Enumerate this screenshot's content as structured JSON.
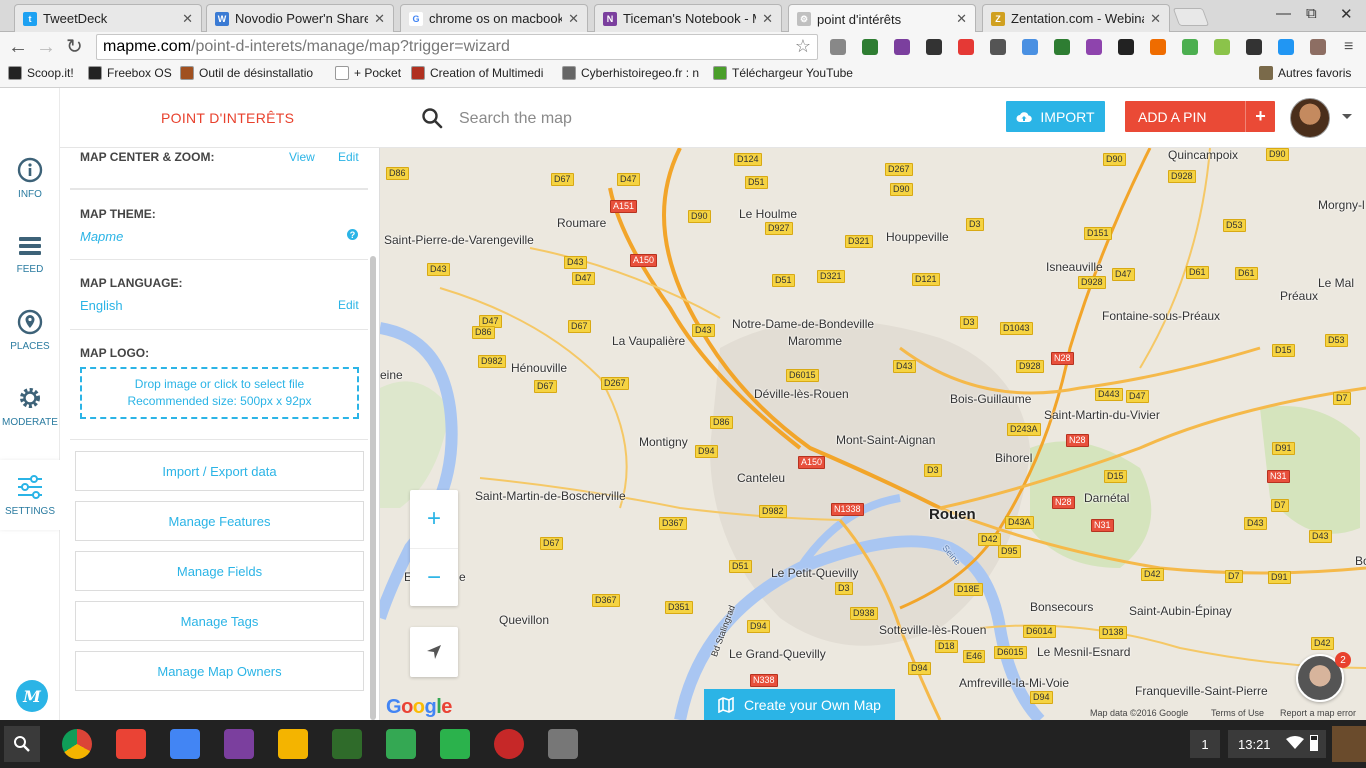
{
  "browser": {
    "tabs": [
      {
        "title": "TweetDeck",
        "color": "#1da1f2",
        "glyph": "t"
      },
      {
        "title": "Novodio Power'n Share - E",
        "color": "#3b7bd4",
        "glyph": "W"
      },
      {
        "title": "chrome os on macbook - G",
        "color": "#ffffff",
        "glyph": "G"
      },
      {
        "title": "Ticeman's Notebook - Mic",
        "color": "#7b3f9e",
        "glyph": "N"
      },
      {
        "title": "point d'intérêts",
        "color": "#c0c0c0",
        "glyph": "⚙",
        "active": true
      },
      {
        "title": "Zentation.com - Webinar s",
        "color": "#d0a020",
        "glyph": "Z"
      }
    ],
    "url_host": "mapme.com",
    "url_path": "/point-d-interets/manage/map?trigger=wizard",
    "bookmarks": [
      {
        "label": "Scoop.it!",
        "color": "#222"
      },
      {
        "label": "Freebox OS",
        "color": "#222"
      },
      {
        "label": "Outil de désinstallatio",
        "color": "#a05020"
      },
      {
        "label": "+ Pocket",
        "color": "#ffffff"
      },
      {
        "label": "Creation of Multimedi",
        "color": "#b03020"
      },
      {
        "label": "Cyberhistoiregeo.fr : n",
        "color": "#666"
      },
      {
        "label": "Téléchargeur YouTube",
        "color": "#4a9e2a"
      }
    ],
    "other_bookmarks": "Autres favoris"
  },
  "header": {
    "title": "POINT D'INTERÊTS",
    "search_placeholder": "Search the map",
    "import_label": "IMPORT",
    "add_pin_label": "ADD A PIN",
    "add_pin_plus": "+"
  },
  "rail": {
    "items": [
      {
        "label": "INFO",
        "icon": "info-icon"
      },
      {
        "label": "FEED",
        "icon": "list-icon"
      },
      {
        "label": "PLACES",
        "icon": "pin-icon"
      },
      {
        "label": "MODERATE",
        "icon": "gear-icon"
      },
      {
        "label": "SETTINGS",
        "icon": "sliders-icon",
        "active": true
      }
    ],
    "logo": "M"
  },
  "settings": {
    "center_zoom": {
      "title": "MAP CENTER & ZOOM:",
      "view": "View",
      "edit": "Edit"
    },
    "theme": {
      "title": "MAP THEME:",
      "value": "Mapme",
      "help": "?"
    },
    "language": {
      "title": "MAP LANGUAGE:",
      "value": "English",
      "edit": "Edit"
    },
    "logo": {
      "title": "MAP LOGO:",
      "drop_line1": "Drop image or click to select file",
      "drop_line2": "Recommended size: 500px x 92px"
    },
    "buttons": [
      "Import / Export data",
      "Manage Features",
      "Manage Fields",
      "Manage Tags",
      "Manage Map Owners"
    ]
  },
  "map": {
    "places": [
      {
        "name": "Quincampoix"
      },
      {
        "name": "Morgny-l"
      },
      {
        "name": "Roumare"
      },
      {
        "name": "Le Houlme"
      },
      {
        "name": "Houppeville"
      },
      {
        "name": "Saint-Pierre-de-Varengeville"
      },
      {
        "name": "Isneauville"
      },
      {
        "name": "Préaux"
      },
      {
        "name": "Fontaine-sous-Préaux"
      },
      {
        "name": "Notre-Dame-de-Bondeville"
      },
      {
        "name": "La Vaupalière"
      },
      {
        "name": "Maromme"
      },
      {
        "name": "Hénouville"
      },
      {
        "name": "eine"
      },
      {
        "name": "Déville-lès-Rouen"
      },
      {
        "name": "Bois-Guillaume"
      },
      {
        "name": "Saint-Martin-du-Vivier"
      },
      {
        "name": "Mont-Saint-Aignan"
      },
      {
        "name": "Montigny"
      },
      {
        "name": "Bihorel"
      },
      {
        "name": "Canteleu"
      },
      {
        "name": "Darnétal"
      },
      {
        "name": "Saint-Martin-de-Boscherville"
      },
      {
        "name": "Rouen",
        "big": true
      },
      {
        "name": "Le Petit-Quevilly"
      },
      {
        "name": "Quevillon"
      },
      {
        "name": "Bonsecours"
      },
      {
        "name": "Saint-Aubin-Épinay"
      },
      {
        "name": "Sotteville-lès-Rouen"
      },
      {
        "name": "Le Grand-Quevilly"
      },
      {
        "name": "Le Mesnil-Esnard"
      },
      {
        "name": "Amfreville-la-Mi-Voie"
      },
      {
        "name": "Franqueville-Saint-Pierre"
      },
      {
        "name": "Le Mal"
      },
      {
        "name": "Bo"
      },
      {
        "name": "E"
      },
      {
        "name": "e"
      }
    ],
    "roads": [
      {
        "name": "D90"
      },
      {
        "name": "D124"
      },
      {
        "name": "D267"
      },
      {
        "name": "D928"
      },
      {
        "name": "D90"
      },
      {
        "name": "D86"
      },
      {
        "name": "D67"
      },
      {
        "name": "D47"
      },
      {
        "name": "D51"
      },
      {
        "name": "D90"
      },
      {
        "name": "A151",
        "red": true
      },
      {
        "name": "D90"
      },
      {
        "name": "D927"
      },
      {
        "name": "D321"
      },
      {
        "name": "D3"
      },
      {
        "name": "D151"
      },
      {
        "name": "D53"
      },
      {
        "name": "D43"
      },
      {
        "name": "A150",
        "red": true
      },
      {
        "name": "D43"
      },
      {
        "name": "D47"
      },
      {
        "name": "D51"
      },
      {
        "name": "D321"
      },
      {
        "name": "D121"
      },
      {
        "name": "D47"
      },
      {
        "name": "D61"
      },
      {
        "name": "D61"
      },
      {
        "name": "D928"
      },
      {
        "name": "D47"
      },
      {
        "name": "D86"
      },
      {
        "name": "D67"
      },
      {
        "name": "D43"
      },
      {
        "name": "D3"
      },
      {
        "name": "D1043"
      },
      {
        "name": "D15"
      },
      {
        "name": "D53"
      },
      {
        "name": "D982"
      },
      {
        "name": "N28",
        "red": true
      },
      {
        "name": "D6015"
      },
      {
        "name": "D43"
      },
      {
        "name": "D928"
      },
      {
        "name": "D67"
      },
      {
        "name": "D267"
      },
      {
        "name": "D443"
      },
      {
        "name": "D47"
      },
      {
        "name": "D7"
      },
      {
        "name": "D86"
      },
      {
        "name": "D243A"
      },
      {
        "name": "N28",
        "red": true
      },
      {
        "name": "D94"
      },
      {
        "name": "A150",
        "red": true
      },
      {
        "name": "D91"
      },
      {
        "name": "D3"
      },
      {
        "name": "D15"
      },
      {
        "name": "N31",
        "red": true
      },
      {
        "name": "N28",
        "red": true
      },
      {
        "name": "D7"
      },
      {
        "name": "D982"
      },
      {
        "name": "N1338",
        "red": true
      },
      {
        "name": "D367"
      },
      {
        "name": "D43A"
      },
      {
        "name": "N31",
        "red": true
      },
      {
        "name": "D43"
      },
      {
        "name": "D42"
      },
      {
        "name": "D95"
      },
      {
        "name": "D43"
      },
      {
        "name": "D67"
      },
      {
        "name": "D51"
      },
      {
        "name": "D42"
      },
      {
        "name": "D7"
      },
      {
        "name": "D91"
      },
      {
        "name": "D367"
      },
      {
        "name": "D351"
      },
      {
        "name": "D3"
      },
      {
        "name": "D18E"
      },
      {
        "name": "D938"
      },
      {
        "name": "D94"
      },
      {
        "name": "D6014"
      },
      {
        "name": "D138"
      },
      {
        "name": "D18"
      },
      {
        "name": "E46"
      },
      {
        "name": "D6015"
      },
      {
        "name": "D42"
      },
      {
        "name": "D94"
      },
      {
        "name": "N338",
        "red": true
      },
      {
        "name": "D94"
      }
    ],
    "river_label": "Seine",
    "street_label": "Bd Stalingrad",
    "zoom_in": "+",
    "zoom_out": "−",
    "create_label": "Create your Own Map",
    "google": "Google",
    "attribution": [
      "Map data ©2016 Google",
      "Terms of Use",
      "Report a map error"
    ],
    "support_badge": "2"
  },
  "taskbar": {
    "apps": [
      {
        "name": "chrome-icon",
        "color": "#db4437"
      },
      {
        "name": "gmail-icon",
        "color": "#ea4335"
      },
      {
        "name": "docs-icon",
        "color": "#4285f4"
      },
      {
        "name": "onenote-icon",
        "color": "#7b3f9e"
      },
      {
        "name": "slides-icon",
        "color": "#f4b400"
      },
      {
        "name": "stocks-icon",
        "color": "#2f6b2a"
      },
      {
        "name": "drive-icon",
        "color": "#34a853"
      },
      {
        "name": "feedly-icon",
        "color": "#2bb24c"
      },
      {
        "name": "photos-icon",
        "color": "#c62828"
      },
      {
        "name": "settings-icon",
        "color": "#777"
      }
    ],
    "window_count": "1",
    "time": "13:21"
  }
}
